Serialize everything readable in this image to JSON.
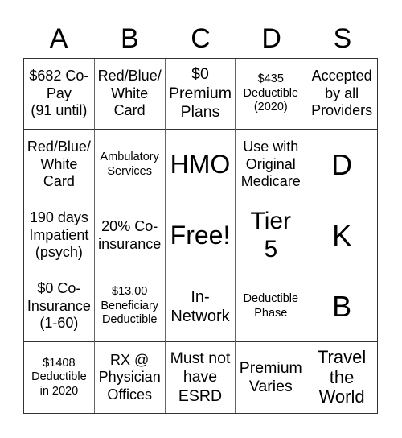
{
  "header": [
    "A",
    "B",
    "C",
    "D",
    "S"
  ],
  "cells": [
    {
      "text": "$682 Co-\nPay\n(91 until)",
      "size": "s18"
    },
    {
      "text": "Red/Blue/\nWhite\nCard",
      "size": "s18"
    },
    {
      "text": "$0\nPremium\nPlans",
      "size": "s19"
    },
    {
      "text": "$435\nDeductible\n(2020)",
      "size": "s14"
    },
    {
      "text": "Accepted\nby all\nProviders",
      "size": "s18"
    },
    {
      "text": "Red/Blue/\nWhite\nCard",
      "size": "s18"
    },
    {
      "text": "Ambulatory\nServices",
      "size": "s14"
    },
    {
      "text": "HMO",
      "size": "s32"
    },
    {
      "text": "Use with\nOriginal\nMedicare",
      "size": "s18"
    },
    {
      "text": "D",
      "size": "s34"
    },
    {
      "text": "190 days\nImpatient\n(psych)",
      "size": "s18"
    },
    {
      "text": "20% Co-\ninsurance",
      "size": "s18"
    },
    {
      "text": "Free!",
      "size": "s32"
    },
    {
      "text": "Tier\n5",
      "size": "s30"
    },
    {
      "text": "K",
      "size": "s34"
    },
    {
      "text": "$0 Co-\nInsurance\n(1-60)",
      "size": "s18"
    },
    {
      "text": "$13.00\nBeneficiary\nDeductible",
      "size": "s14"
    },
    {
      "text": "In-\nNetwork",
      "size": "s20"
    },
    {
      "text": "Deductible\nPhase",
      "size": "s14"
    },
    {
      "text": "B",
      "size": "s34"
    },
    {
      "text": "$1408\nDeductible\nin 2020",
      "size": "s14"
    },
    {
      "text": "RX @\nPhysician\nOffices",
      "size": "s18"
    },
    {
      "text": "Must not\nhave\nESRD",
      "size": "s19"
    },
    {
      "text": "Premium\nVaries",
      "size": "s19"
    },
    {
      "text": "Travel\nthe\nWorld",
      "size": "s22"
    }
  ]
}
